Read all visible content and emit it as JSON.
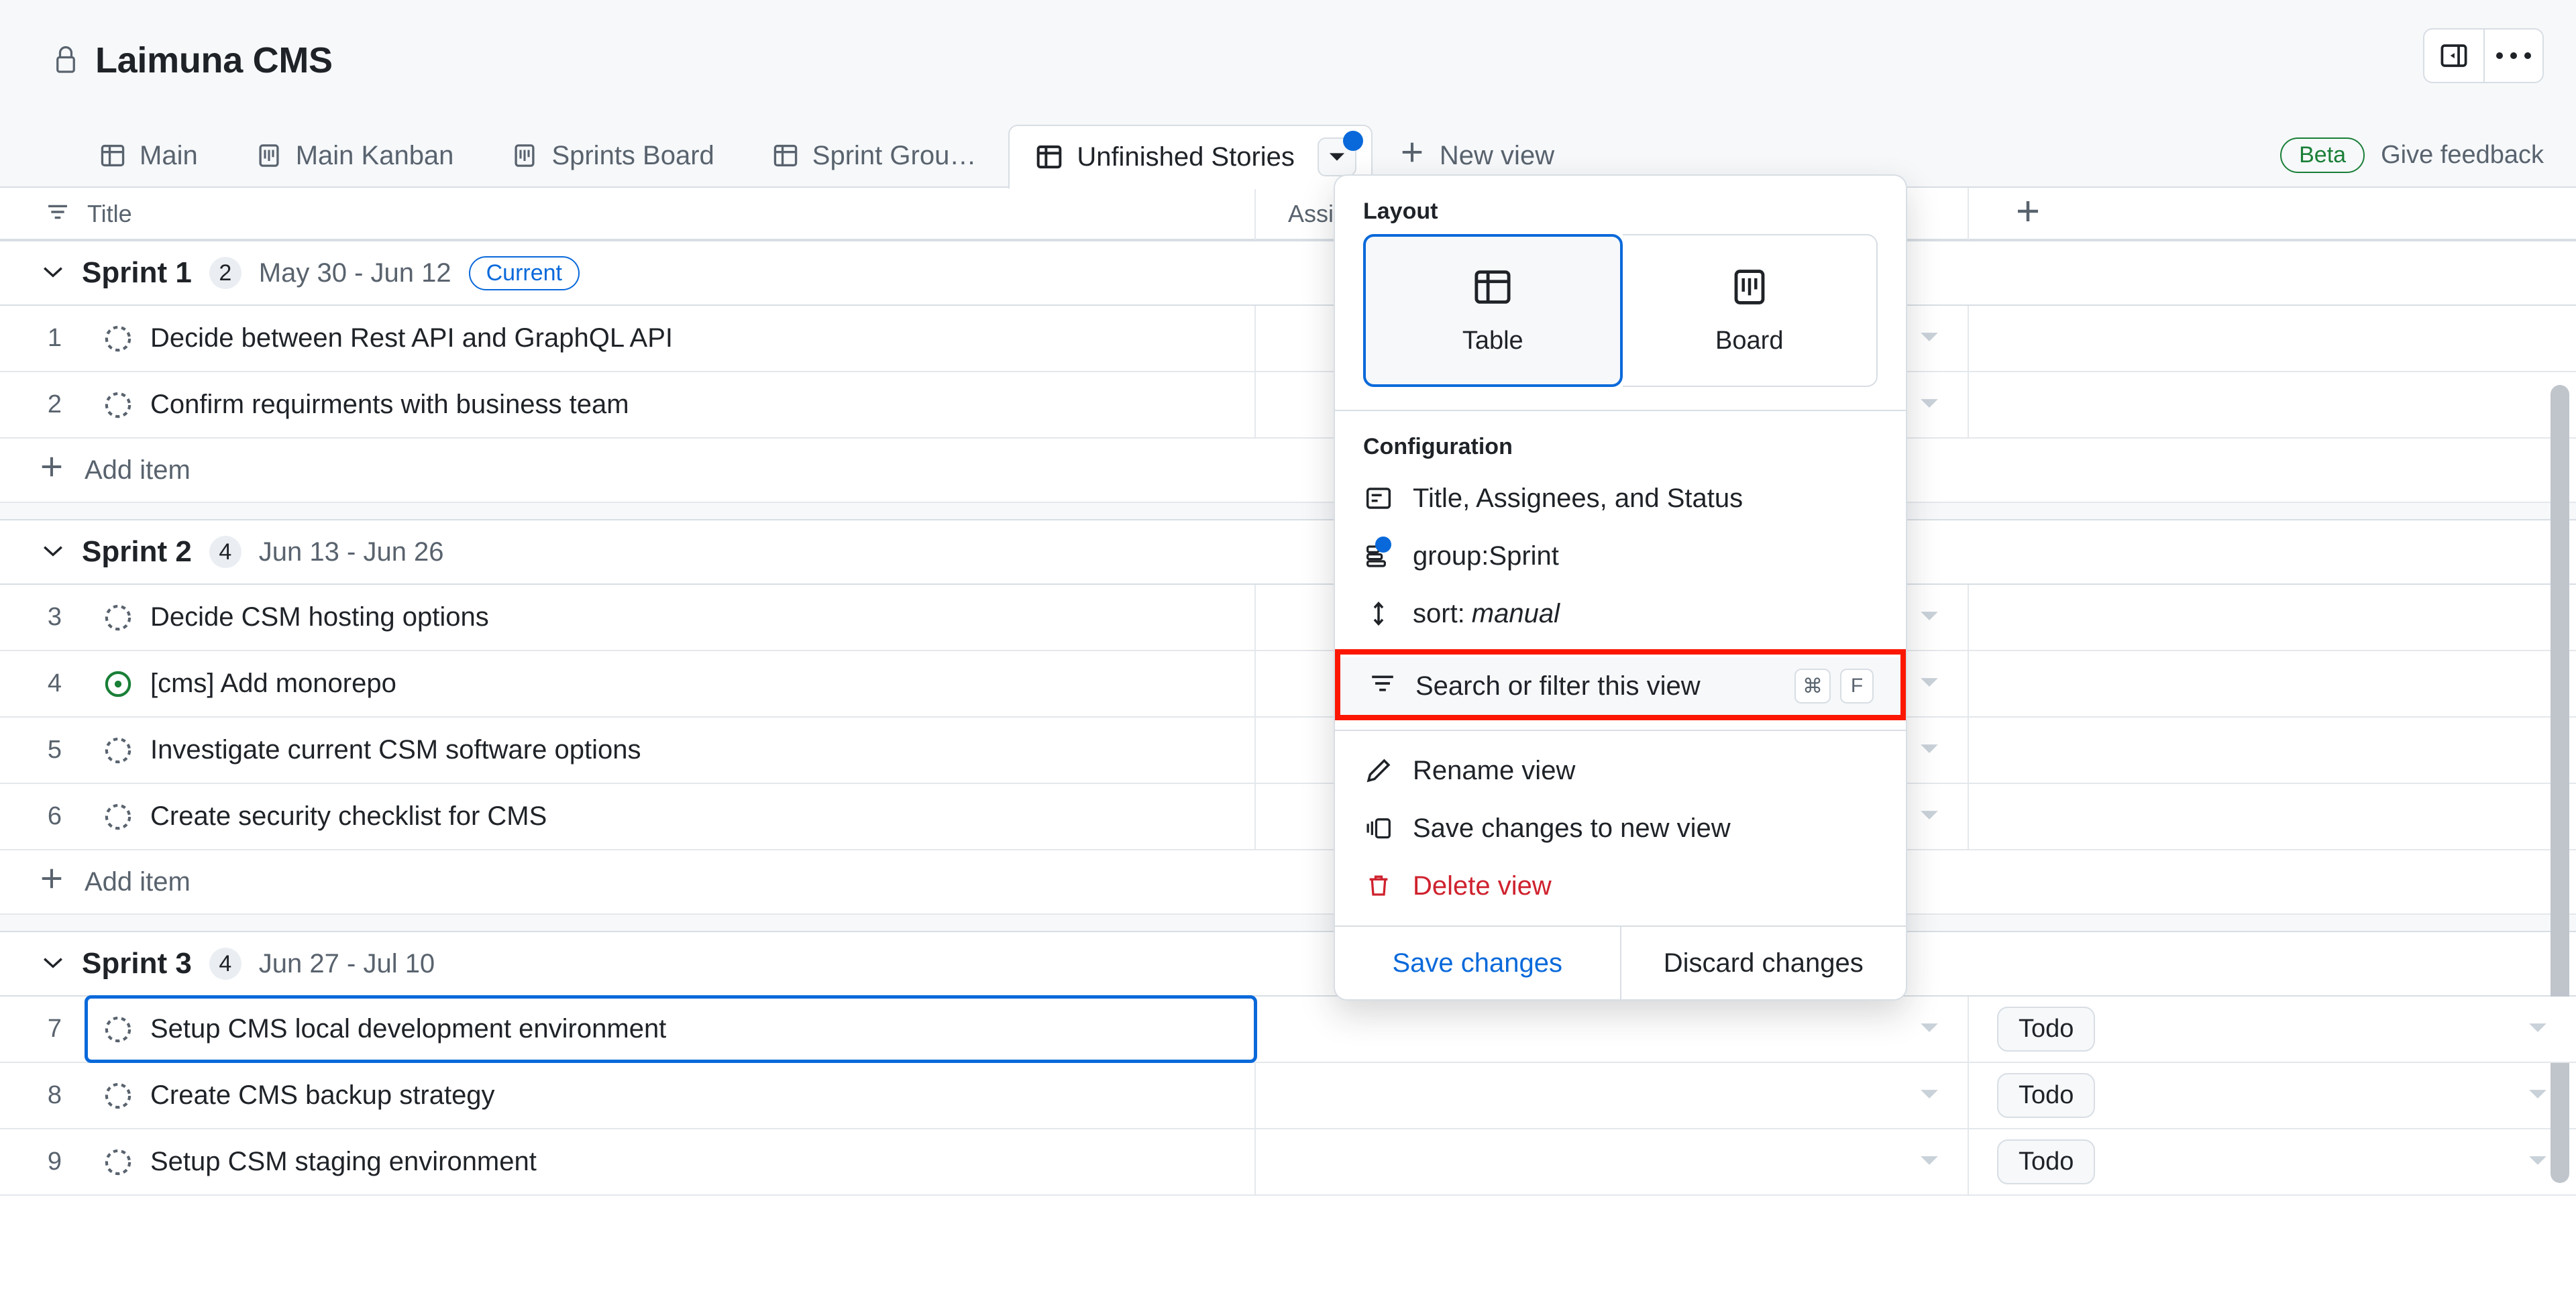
{
  "header": {
    "lock_icon": "lock-icon",
    "project_title": "Laimuna CMS",
    "sidebar_toggle_icon": "sidebar-collapse-icon",
    "more_icon": "kebab-menu-icon"
  },
  "tabs": {
    "items": [
      {
        "label": "Main",
        "icon": "table-icon",
        "active": false
      },
      {
        "label": "Main Kanban",
        "icon": "board-icon",
        "active": false
      },
      {
        "label": "Sprints Board",
        "icon": "board-icon",
        "active": false
      },
      {
        "label": "Sprint Grou…",
        "icon": "table-icon",
        "active": false
      },
      {
        "label": "Unfinished Stories",
        "icon": "table-icon",
        "active": true
      }
    ],
    "new_view_label": "New view",
    "new_view_icon": "plus-icon",
    "active_tab_caret_icon": "chevron-down-icon",
    "active_tab_unsaved_dot": true
  },
  "feedback": {
    "beta_label": "Beta",
    "give_feedback_label": "Give feedback"
  },
  "columns": {
    "title": "Title",
    "title_filter_icon": "filter-icon",
    "assignees": "Assign",
    "add_column_icon": "plus-icon"
  },
  "groups": [
    {
      "name": "Sprint 1",
      "count": "2",
      "dates": "May 30 - Jun 12",
      "badge": "Current",
      "collapse_icon": "chevron-down-icon",
      "rows": [
        {
          "num": "1",
          "title": "Decide between Rest API and GraphQL API",
          "icon": "issue-open-dashed-icon",
          "status": ""
        },
        {
          "num": "2",
          "title": "Confirm requirments with business team",
          "icon": "issue-open-dashed-icon",
          "status": ""
        }
      ],
      "add_item_label": "Add item"
    },
    {
      "name": "Sprint 2",
      "count": "4",
      "dates": "Jun 13 - Jun 26",
      "badge": "",
      "collapse_icon": "chevron-down-icon",
      "rows": [
        {
          "num": "3",
          "title": "Decide CSM hosting options",
          "icon": "issue-open-dashed-icon",
          "status": ""
        },
        {
          "num": "4",
          "title": "[cms] Add monorepo",
          "icon": "issue-open-green-icon",
          "status": ""
        },
        {
          "num": "5",
          "title": "Investigate current CSM software options",
          "icon": "issue-open-dashed-icon",
          "status": ""
        },
        {
          "num": "6",
          "title": "Create security checklist for CMS",
          "icon": "issue-open-dashed-icon",
          "status": ""
        }
      ],
      "add_item_label": "Add item"
    },
    {
      "name": "Sprint 3",
      "count": "4",
      "dates": "Jun 27 - Jul 10",
      "badge": "",
      "collapse_icon": "chevron-down-icon",
      "rows": [
        {
          "num": "7",
          "title": "Setup CMS local development environment",
          "icon": "issue-open-dashed-icon",
          "status": "Todo",
          "selected": true
        },
        {
          "num": "8",
          "title": "Create CMS backup strategy",
          "icon": "issue-open-dashed-icon",
          "status": "Todo"
        },
        {
          "num": "9",
          "title": "Setup CSM staging environment",
          "icon": "issue-open-dashed-icon",
          "status": "Todo"
        }
      ],
      "add_item_label": ""
    }
  ],
  "menu": {
    "layout_label": "Layout",
    "layout_options": [
      {
        "label": "Table",
        "icon": "table-icon",
        "selected": true
      },
      {
        "label": "Board",
        "icon": "board-icon",
        "selected": false
      }
    ],
    "configuration_label": "Configuration",
    "config_items": [
      {
        "label": "Title, Assignees, and Status",
        "icon": "fields-icon",
        "dot": false
      },
      {
        "label": "group:Sprint",
        "icon": "group-icon",
        "dot": true
      },
      {
        "label_prefix": "sort: ",
        "label_em": "manual",
        "icon": "sort-icon",
        "dot": false
      }
    ],
    "filter_item": {
      "label": "Search or filter this view",
      "icon": "filter-icon",
      "kbd": [
        "⌘",
        "F"
      ],
      "highlight_color": "#fc1703"
    },
    "actions": [
      {
        "label": "Rename view",
        "icon": "pencil-icon",
        "danger": false
      },
      {
        "label": "Save changes to new view",
        "icon": "duplicate-icon",
        "danger": false
      },
      {
        "label": "Delete view",
        "icon": "trash-icon",
        "danger": true
      }
    ],
    "footer": {
      "save_label": "Save changes",
      "discard_label": "Discard changes"
    }
  },
  "colors": {
    "accent_blue": "#0969da",
    "danger_red": "#cf222e",
    "highlight_red": "#fc1703",
    "success_green": "#1a7f37",
    "border": "#d8dee4",
    "surface": "#f6f8fa"
  }
}
